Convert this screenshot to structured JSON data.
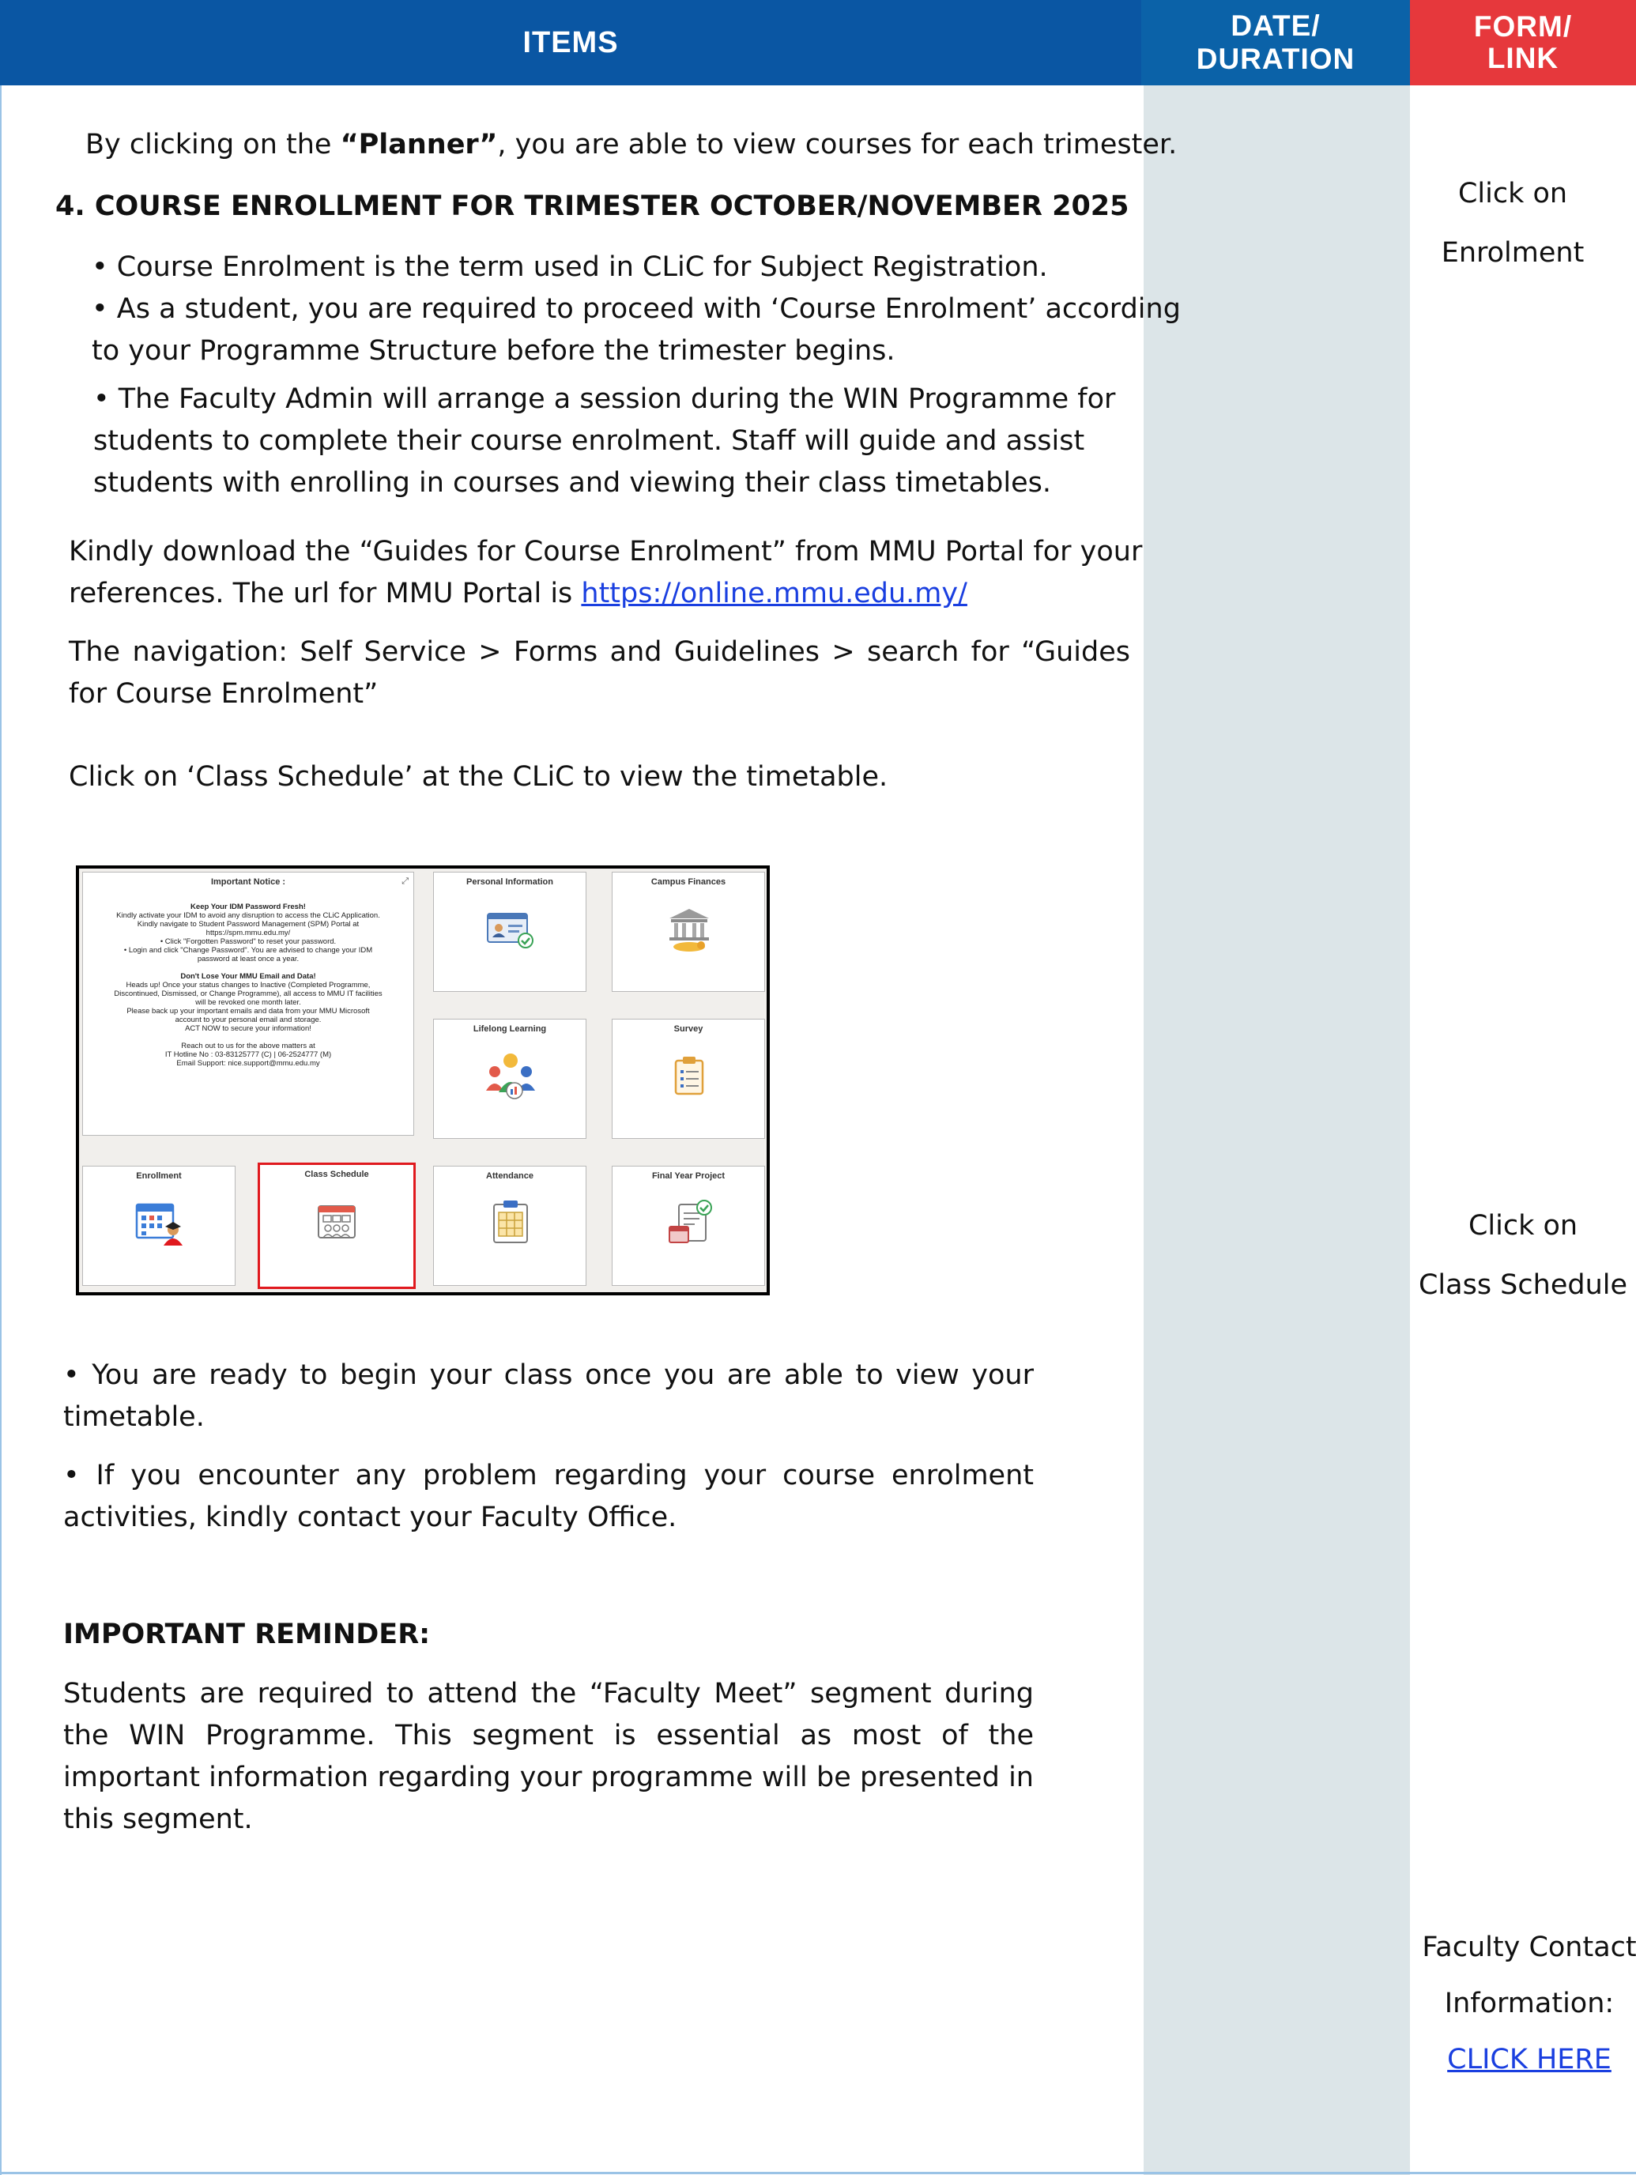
{
  "header": {
    "items": "ITEMS",
    "date_line1": "DATE/",
    "date_line2": "DURATION",
    "form_line1": "FORM/",
    "form_line2": "LINK"
  },
  "content": {
    "planner_pre": "By clicking on the ",
    "planner_bold": "“Planner”",
    "planner_post": ", you are able to view courses for each trimester.",
    "section_heading": "4. COURSE ENROLLMENT FOR TRIMESTER OCTOBER/NOVEMBER 2025",
    "bullet1": "• Course Enrolment is the term used in CLiC for Subject Registration.",
    "bullet2_line1": "• As a student, you are required to proceed with ‘Course Enrolment’ according",
    "bullet2_line2": "to your Programme Structure before the trimester begins.",
    "bullet3_line1": "• The Faculty Admin will arrange a session during the WIN Programme for",
    "bullet3_line2": "students to complete their course enrolment. Staff will guide and assist",
    "bullet3_line3": "students with enrolling in courses and viewing their class timetables.",
    "guide_line1": "Kindly download the “Guides for Course Enrolment” from MMU Portal for your",
    "guide_line2_pre": "references. The url for MMU Portal is ",
    "portal_url": "https://online.mmu.edu.my/",
    "navigation": "The navigation: Self Service > Forms and Guidelines > search for “Guides for Course Enrolment”",
    "class_schedule_note": "Click on ‘Class Schedule’ at the CLiC to view the timetable.",
    "ready_bullet": "• You are ready to begin your class once you are able to view your timetable.",
    "problem_bullet": "• If you encounter any problem regarding your course enrolment activities, kindly contact your Faculty Office.",
    "reminder_heading": "IMPORTANT REMINDER:",
    "reminder_text": "Students are required to attend the “Faculty Meet” segment during the WIN Programme. This segment is essential as most of the important information regarding your programme will be presented in this segment."
  },
  "side": {
    "enrol_line1": "Click on",
    "enrol_line2": "Enrolment",
    "sched_line1": "Click on",
    "sched_line2": "Class Schedule",
    "contact_line1": "Faculty Contact",
    "contact_line2": "Information:",
    "contact_link": "CLICK HERE"
  },
  "screenshot": {
    "tiles": {
      "notice": "Important Notice :",
      "personal": "Personal Information",
      "finances": "Campus Finances",
      "lifelong": "Lifelong Learning",
      "survey": "Survey",
      "enrollment": "Enrollment",
      "class_schedule": "Class Schedule",
      "attendance": "Attendance",
      "fyp": "Final Year Project"
    },
    "notice_lines": {
      "h1": "Keep Your IDM Password Fresh!",
      "l1": "Kindly activate your IDM to avoid any disruption to access the CLiC Application.",
      "l2": "Kindly navigate to Student Password Management (SPM) Portal at",
      "l3": "https://spm.mmu.edu.my/",
      "l4": "• Click \"Forgotten Password\" to reset your password.",
      "l5": "• Login and click \"Change Password\". You are advised to change your IDM",
      "l6": "password at least once a year.",
      "h2": "Don't Lose Your MMU Email and Data!",
      "l7": "Heads up! Once your status changes to Inactive (Completed Programme,",
      "l8": "Discontinued, Dismissed, or Change Programme), all access to MMU IT facilities",
      "l9": "will be revoked one month later.",
      "l10": "Please back up your important emails and data from your MMU Microsoft",
      "l11": "account to your personal email and storage.",
      "l12": "ACT NOW to secure your information!",
      "l13": "Reach out to us for the above matters at",
      "l14": "IT Hotline No : 03-83125777 (C) | 06-2524777 (M)",
      "l15": "Email Support: nice.support@mmu.edu.my"
    }
  },
  "colors": {
    "items_header": "#0a56a3",
    "date_header": "#0b62a8",
    "form_header": "#e6383c",
    "date_column": "#dce5e8",
    "link": "#1a3fe0",
    "selected_tile": "#e0191e"
  }
}
